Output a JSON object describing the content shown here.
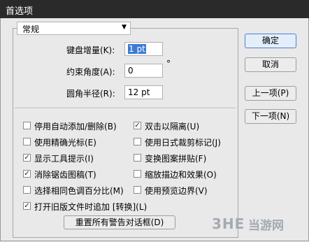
{
  "window": {
    "title": "首选项"
  },
  "dropdown": {
    "value": "常规"
  },
  "fields": {
    "keyboard_increment": {
      "label": "键盘增量(K):",
      "value": "1 pt"
    },
    "constrain_angle": {
      "label": "约束角度(A):",
      "value": "0",
      "unit": "°"
    },
    "corner_radius": {
      "label": "圆角半径(R):",
      "value": "12 pt"
    }
  },
  "checkboxes": [
    {
      "label": "停用自动添加/删除(B)",
      "checked": false
    },
    {
      "label": "双击以隔离(U)",
      "checked": true
    },
    {
      "label": "使用精确光标(E)",
      "checked": false
    },
    {
      "label": "使用日式裁剪标记(J)",
      "checked": false
    },
    {
      "label": "显示工具提示(I)",
      "checked": true
    },
    {
      "label": "变换图案拼贴(F)",
      "checked": false
    },
    {
      "label": "消除锯齿图稿(T)",
      "checked": true
    },
    {
      "label": "缩放描边和效果(O)",
      "checked": false
    },
    {
      "label": "选择相同色调百分比(M)",
      "checked": false
    },
    {
      "label": "使用预览边界(V)",
      "checked": false
    },
    {
      "label": "打开旧版文件时追加 [转换](L)",
      "checked": true
    }
  ],
  "buttons": {
    "reset_warnings": "重置所有警告对话框(D)",
    "ok": "确定",
    "cancel": "取消",
    "prev": "上一项(P)",
    "next": "下一项(N)"
  },
  "watermark": {
    "logo": "3HE",
    "text": "当游网"
  }
}
